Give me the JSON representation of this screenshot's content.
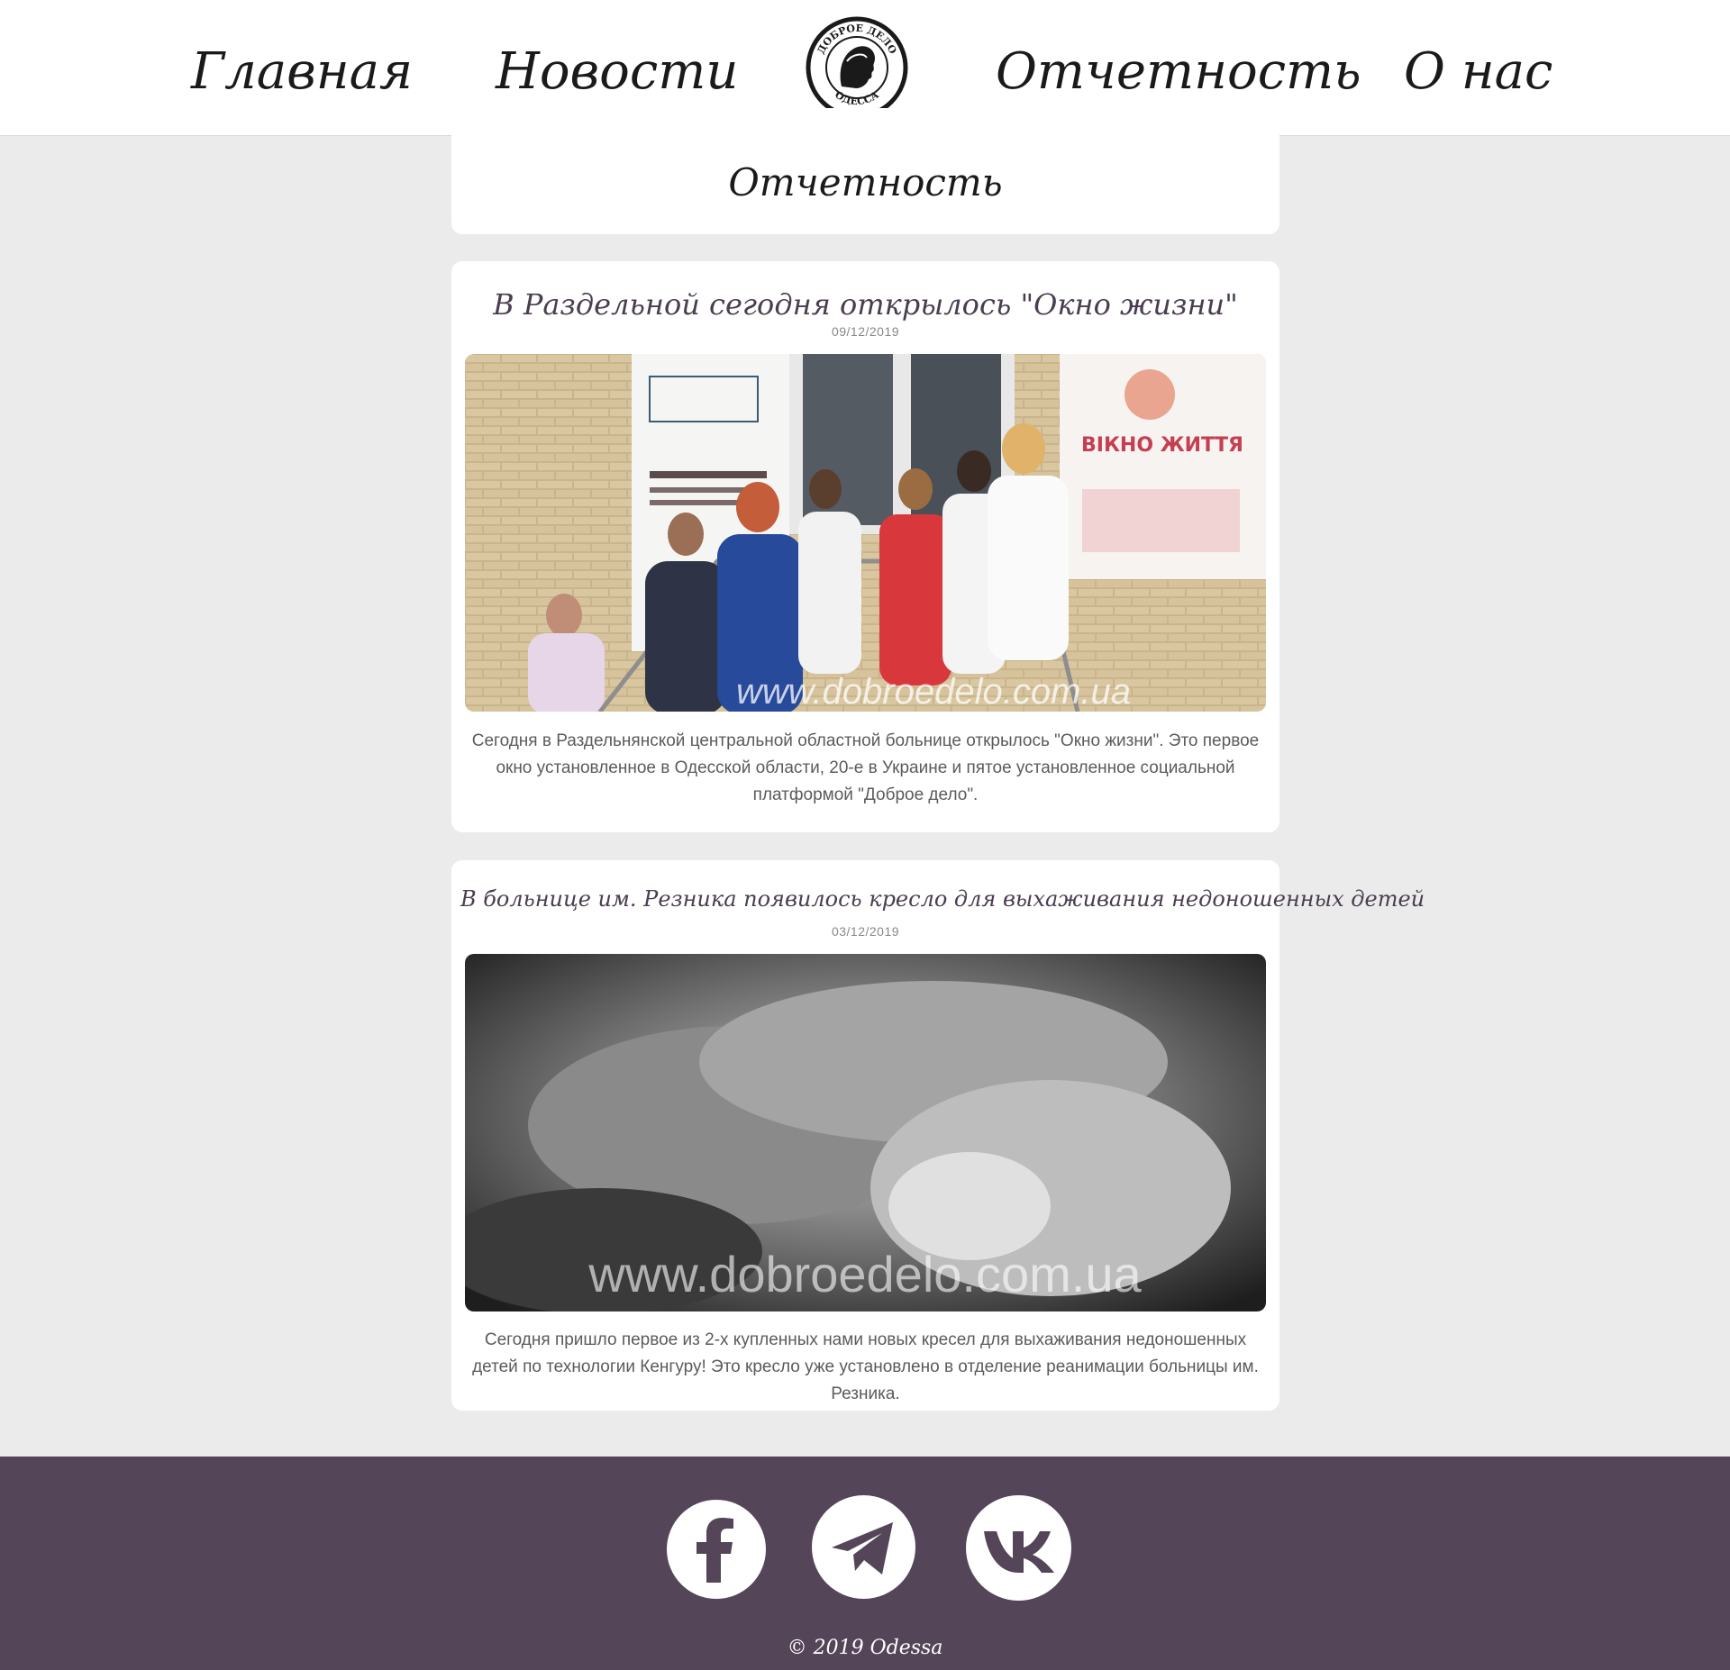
{
  "nav": {
    "home": "Главная",
    "news": "Новости",
    "reports": "Отчетность",
    "about": "О нас",
    "logo_text_top": "ДОБРОЕ ДЕЛО",
    "logo_text_bottom": "ОДЕССА"
  },
  "page_title": "Отчетность",
  "posts": [
    {
      "title": "В Раздельной сегодня открылось \"Окно жизни\"",
      "date": "09/12/2019",
      "image_watermark": "www.dobroedelo.com.ua",
      "image_sign_title": "ВІКНО ЖИТТЯ",
      "text": "Сегодня в Раздельнянской центральной областной больнице открылось \"Окно жизни\". Это первое окно установленное в Одесской области, 20-е в Украине и пятое установленное социальной платформой \"Доброе дело\"."
    },
    {
      "title": "В больнице им. Резника появилось кресло для выхаживания недоношенных детей",
      "date": "03/12/2019",
      "image_watermark": "www.dobroedelo.com.ua",
      "text": "Сегодня пришло первое из 2-х купленных нами новых кресел для выхаживания недоношенных детей по технологии Кенгуру! Это кресло уже установлено в отделение реанимации больницы им. Резника."
    }
  ],
  "footer": {
    "social": [
      "facebook-icon",
      "telegram-icon",
      "vk-icon"
    ],
    "copyright": "© 2019 Odessa"
  },
  "colors": {
    "footer_bg": "#544559",
    "page_bg": "#ebebec",
    "title_color": "#4a3d50"
  }
}
